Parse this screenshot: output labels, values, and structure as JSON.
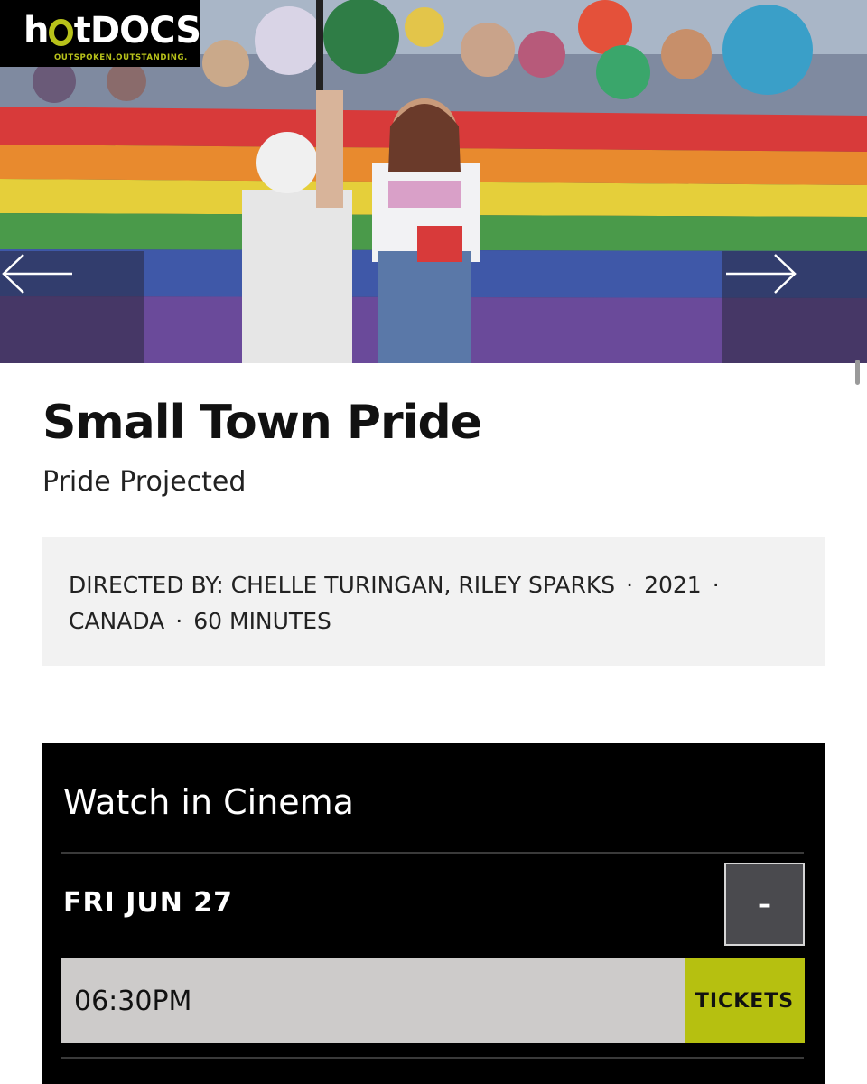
{
  "brand": {
    "logo_text": "hotdocs",
    "tagline": "OUTSPOKEN.OUTSTANDING.",
    "accent_color": "#b8c21a"
  },
  "hero": {
    "prev_icon": "arrow-left-icon",
    "next_icon": "arrow-right-icon"
  },
  "film": {
    "title": "Small Town Pride",
    "program": "Pride Projected",
    "directed_by": "DIRECTED BY: CHELLE TURINGAN, RILEY SPARKS",
    "year": "2021",
    "country": "CANADA",
    "runtime": "60 MINUTES",
    "separator": "·"
  },
  "cinema": {
    "heading": "Watch in Cinema",
    "date": "FRI JUN 27",
    "collapse_label": "–",
    "showtimes": [
      {
        "time": "06:30PM",
        "button": "TICKETS"
      }
    ]
  }
}
